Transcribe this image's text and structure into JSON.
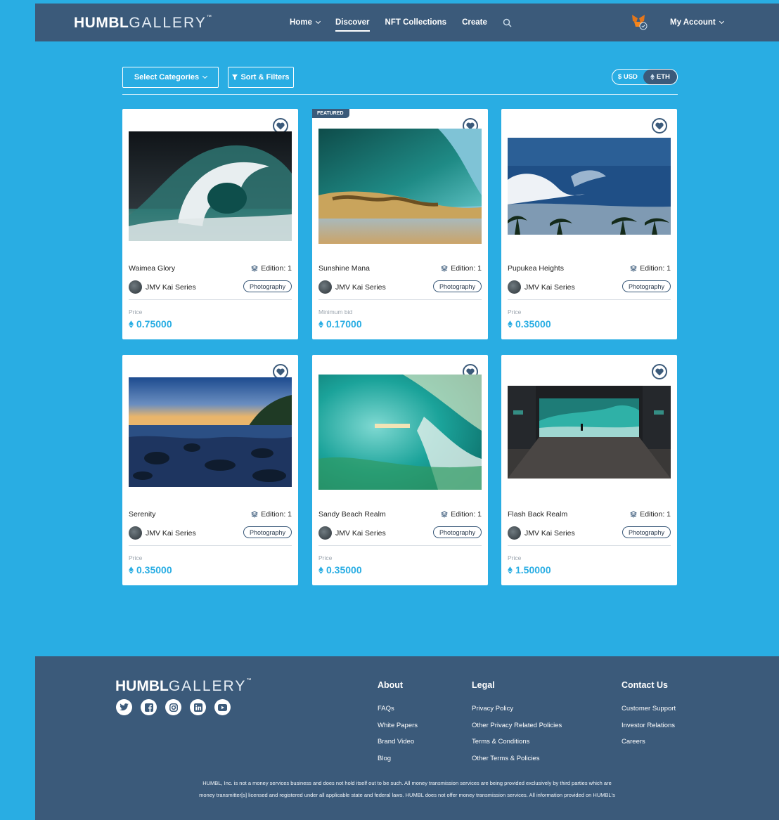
{
  "colors": {
    "page_bg": "#29ade3",
    "bar_bg": "#3b5a7a",
    "accent": "#29ade3",
    "white": "#ffffff"
  },
  "header": {
    "logo_bold": "HUMBL",
    "logo_light": "GALLERY",
    "nav": [
      {
        "label": "Home",
        "has_dropdown": true
      },
      {
        "label": "Discover",
        "active": true
      },
      {
        "label": "NFT Collections"
      },
      {
        "label": "Create"
      }
    ],
    "account_label": "My Account",
    "icons": [
      "search-icon",
      "metamask-wallet-icon"
    ]
  },
  "filters": {
    "categories_label": "Select Categories",
    "sort_label": "Sort & Filters",
    "currency_usd": "$ USD",
    "currency_eth": "ETH",
    "selected_currency": "ETH"
  },
  "cards": [
    {
      "title": "Waimea Glory",
      "edition": "Edition: 1",
      "creator": "JMV Kai Series",
      "category": "Photography",
      "price_label": "Price",
      "price": "0.75000",
      "featured": false
    },
    {
      "title": "Sunshine Mana",
      "edition": "Edition: 1",
      "creator": "JMV Kai Series",
      "category": "Photography",
      "price_label": "Minimum bid",
      "price": "0.17000",
      "featured": true,
      "featured_label": "FEATURED"
    },
    {
      "title": "Pupukea Heights",
      "edition": "Edition: 1",
      "creator": "JMV Kai Series",
      "category": "Photography",
      "price_label": "Price",
      "price": "0.35000",
      "featured": false
    },
    {
      "title": "Serenity",
      "edition": "Edition: 1",
      "creator": "JMV Kai Series",
      "category": "Photography",
      "price_label": "Price",
      "price": "0.35000",
      "featured": false
    },
    {
      "title": "Sandy Beach Realm",
      "edition": "Edition: 1",
      "creator": "JMV Kai Series",
      "category": "Photography",
      "price_label": "Price",
      "price": "0.35000",
      "featured": false
    },
    {
      "title": "Flash Back Realm",
      "edition": "Edition: 1",
      "creator": "JMV Kai Series",
      "category": "Photography",
      "price_label": "Price",
      "price": "1.50000",
      "featured": false
    }
  ],
  "footer": {
    "logo_bold": "HUMBL",
    "logo_light": "GALLERY",
    "socials": [
      "twitter-icon",
      "facebook-icon",
      "instagram-icon",
      "linkedin-icon",
      "youtube-icon"
    ],
    "about": {
      "heading": "About",
      "links": [
        "FAQs",
        "White Papers",
        "Brand Video",
        "Blog"
      ]
    },
    "legal": {
      "heading": "Legal",
      "links": [
        "Privacy Policy",
        "Other Privacy Related Policies",
        "Terms & Conditions",
        "Other Terms & Policies"
      ]
    },
    "contact": {
      "heading": "Contact Us",
      "links": [
        "Customer Support",
        "Investor Relations",
        "Careers"
      ]
    },
    "disclaimer_line1": "HUMBL, Inc. is not a money services business and does not hold itself out to be such. All money transmission services are being provided exclusively by third parties which are",
    "disclaimer_line2": "money transmitter[s] licensed and registered under all applicable state and federal laws. HUMBL does not offer money transmission services. All information provided on HUMBL's"
  }
}
